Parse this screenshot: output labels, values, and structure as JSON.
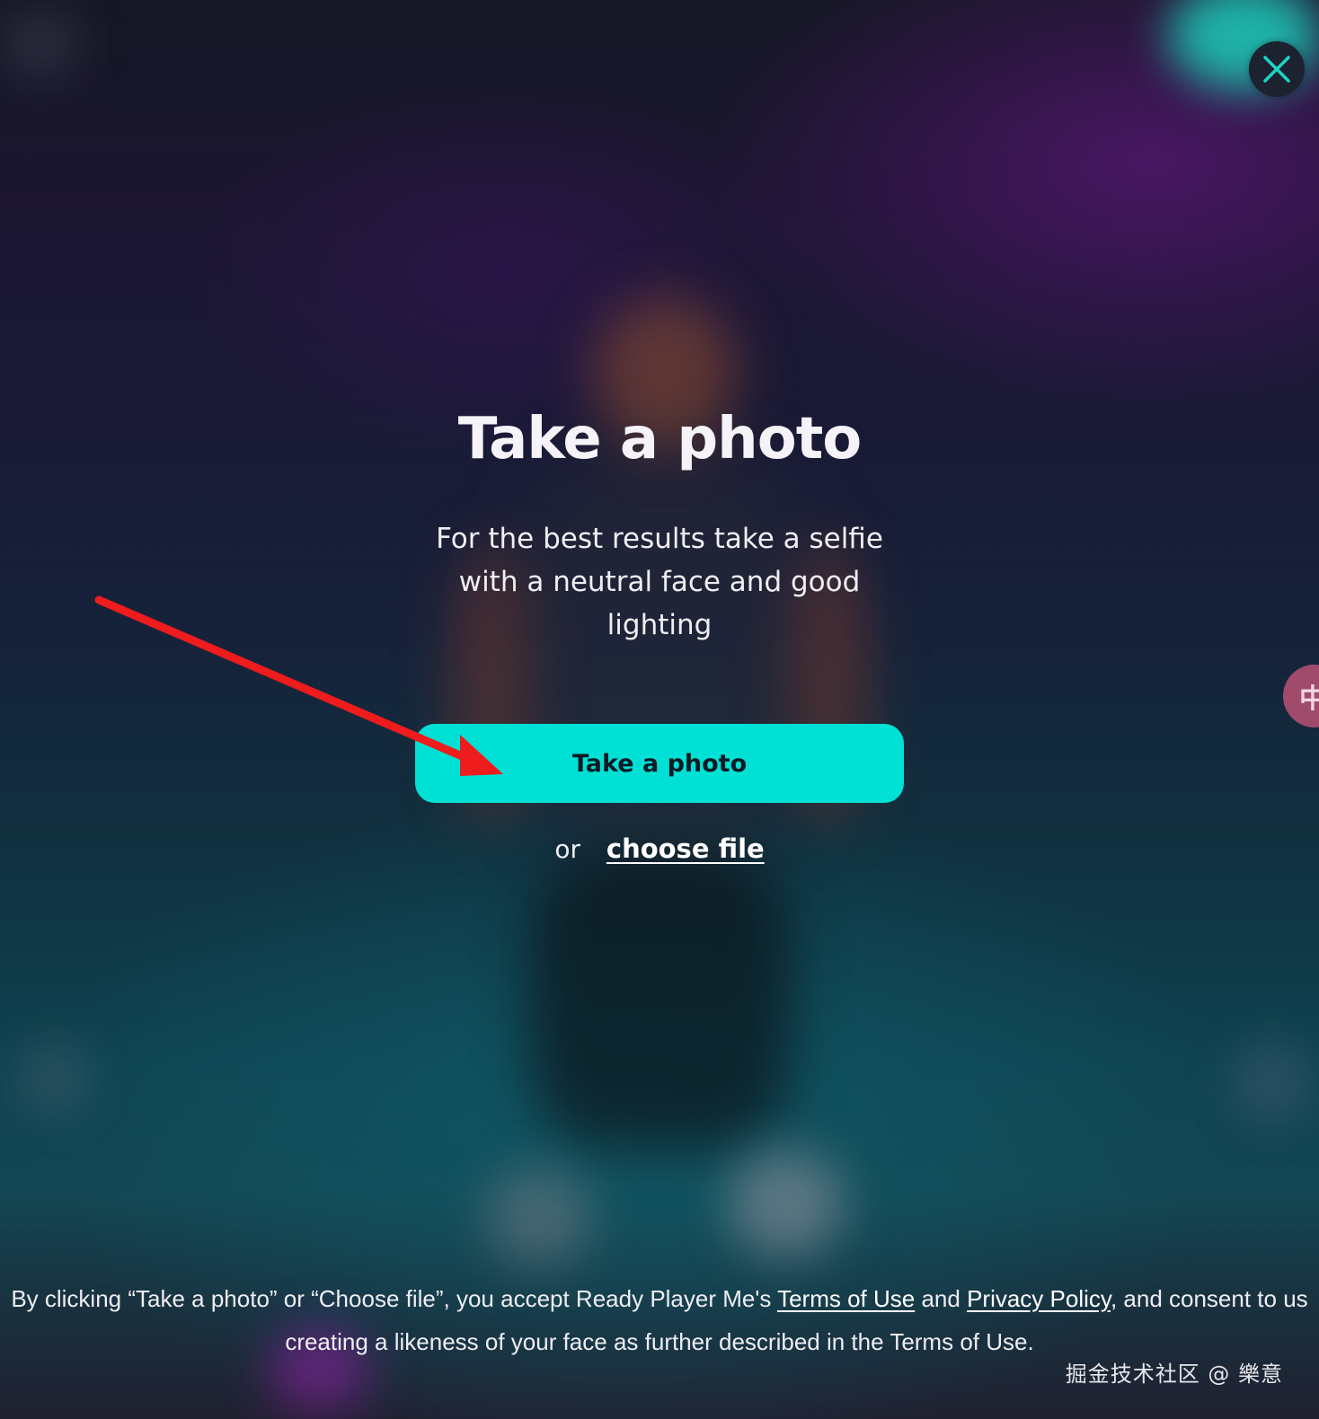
{
  "header": {
    "close_icon": "close-x-icon",
    "close_color": "#1ed3c4"
  },
  "side_tab": {
    "glyph": "中"
  },
  "main": {
    "title": "Take a photo",
    "subtitle": "For the best results take a selfie with a neutral face and good lighting",
    "primary_button_label": "Take a photo",
    "or_text": "or",
    "choose_file_label": "choose file"
  },
  "legal": {
    "prefix": "By clicking “Take a photo” or “Choose file”, you accept Ready Player Me's ",
    "terms_link": "Terms of Use",
    "and_text": " and ",
    "privacy_link": "Privacy Policy",
    "suffix": ", and consent to us creating a likeness of your face as further described in the Terms of Use."
  },
  "watermark": "掘金技术社区 @ 樂意",
  "colors": {
    "accent": "#00e0d4",
    "arrow": "#ee1c1c",
    "background_top": "#151725",
    "background_mid": "#10313f"
  }
}
